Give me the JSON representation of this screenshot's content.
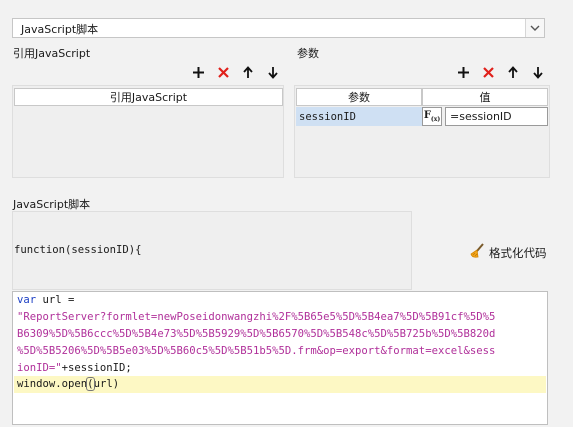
{
  "script_type_select": {
    "value": "JavaScript脚本"
  },
  "ref_js": {
    "title": "引用JavaScript",
    "column_header": "引用JavaScript"
  },
  "params": {
    "title": "参数",
    "columns": [
      "参数",
      "值"
    ],
    "rows": [
      {
        "name": "sessionID",
        "value": "=sessionID"
      }
    ],
    "formula_button": "F(x)"
  },
  "js_script": {
    "title": "JavaScript脚本",
    "function_signature": "function(sessionID){",
    "format_code_button": "格式化代码",
    "code": {
      "line1_kw": "var",
      "line1_rest": " url =",
      "line2": "\"ReportServer?formlet=newPoseidonwangzhi%2F%5B65e5%5D%5B4ea7%5D%5B91cf%5D%5",
      "line3": "B6309%5D%5B6ccc%5D%5B4e73%5D%5B5929%5D%5B6570%5D%5B548c%5D%5B725b%5D%5B820d",
      "line4": "%5D%5B5206%5D%5B5e03%5D%5B60c5%5D%5B51b5%5D.frm&op=export&format=excel&sess",
      "line5_str": "ionID=\"",
      "line5_rest": "+sessionID;",
      "line6_pre": "window.open",
      "line6_mid": "(",
      "line6_post": "url)"
    }
  },
  "icons": [
    "add-icon",
    "delete-icon",
    "move-up-icon",
    "move-down-icon",
    "chevron-down-icon",
    "broom-icon"
  ],
  "colors": {
    "accent_red": "#e0201b",
    "keyword_blue": "#1c3fc4",
    "string_purple": "#b0309a",
    "highlight_line": "#fdf8c4",
    "selected_cell": "#cfe0f3"
  }
}
